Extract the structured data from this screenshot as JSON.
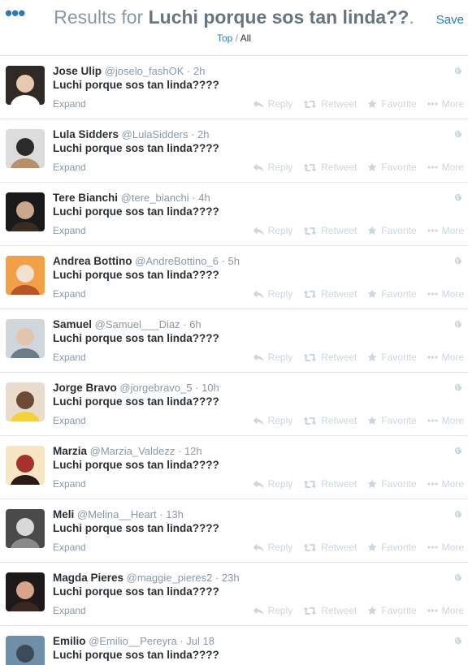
{
  "header": {
    "menu_glyph": "•••",
    "title_prefix": "Results for ",
    "query": "Luchi porque sos tan linda??",
    "title_suffix": ".",
    "save_label": "Save",
    "filter_top": "Top",
    "filter_sep": " / ",
    "filter_all": "All"
  },
  "actions": {
    "reply": "Reply",
    "retweet": "Retweet",
    "favorite": "Favorite",
    "more": "More",
    "expand": "Expand"
  },
  "tweets": [
    {
      "name": "Jose Ulip",
      "handle": "@joselo_fashOK",
      "time": "2h",
      "text": "Luchi porque sos tan linda????"
    },
    {
      "name": "Lula Sidders",
      "handle": "@LulaSidders",
      "time": "2h",
      "text": "Luchi porque sos tan linda????"
    },
    {
      "name": "Tere Bianchi",
      "handle": "@tere_bianchi",
      "time": "4h",
      "text": "Luchi porque sos tan linda????"
    },
    {
      "name": "Andrea Bottino",
      "handle": "@AndreBottino_6",
      "time": "5h",
      "text": "Luchi porque sos tan linda????"
    },
    {
      "name": "Samuel",
      "handle": "@Samuel___Diaz",
      "time": "6h",
      "text": "Luchi porque sos tan linda????"
    },
    {
      "name": "Jorge Bravo",
      "handle": "@jorgebravo_5",
      "time": "10h",
      "text": "Luchi porque sos tan linda????"
    },
    {
      "name": "Marzia",
      "handle": "@Marzia_Valdezz",
      "time": "12h",
      "text": "Luchi porque sos tan linda????"
    },
    {
      "name": "Meli",
      "handle": "@Melina__Heart",
      "time": "13h",
      "text": "Luchi porque sos tan linda????"
    },
    {
      "name": "Magda Pieres",
      "handle": "@maggie_pieres2",
      "time": "23h",
      "text": "Luchi porque sos tan linda????"
    },
    {
      "name": "Emilio",
      "handle": "@Emilio__Pereyra",
      "time": "Jul 18",
      "text": "Luchi porque sos tan linda????"
    }
  ],
  "colors": {
    "link": "#2b7bb9",
    "muted": "#8899a6",
    "action_icon": "#ccd6dd",
    "text": "#292f33",
    "divider": "#e1e8ed"
  },
  "icons": {
    "menu": "ellipsis-icon",
    "reply": "reply-arrow-icon",
    "retweet": "retweet-icon",
    "favorite": "star-icon",
    "more": "ellipsis-icon",
    "globe": "globe-icon"
  }
}
